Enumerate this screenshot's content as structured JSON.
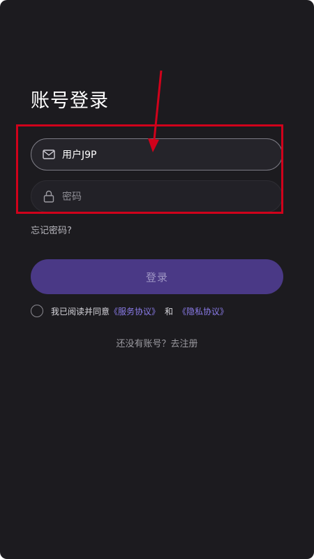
{
  "login": {
    "title": "账号登录",
    "username": {
      "value": "用户J9P",
      "icon": "mail-icon"
    },
    "password": {
      "placeholder": "密码",
      "icon": "lock-icon"
    },
    "forgot_password": "忘记密码?",
    "submit_label": "登录",
    "agreement": {
      "prefix": "我已阅读并同意",
      "service_link": "《服务协议》",
      "conjunction": "和",
      "privacy_link": "《隐私协议》",
      "checked": false
    },
    "register_link": "还没有账号？去注册"
  },
  "colors": {
    "background": "#1c1b1f",
    "field": "#25242a",
    "button": "#4a3986",
    "link": "#8a7be8",
    "annotation": "#d0021b"
  }
}
